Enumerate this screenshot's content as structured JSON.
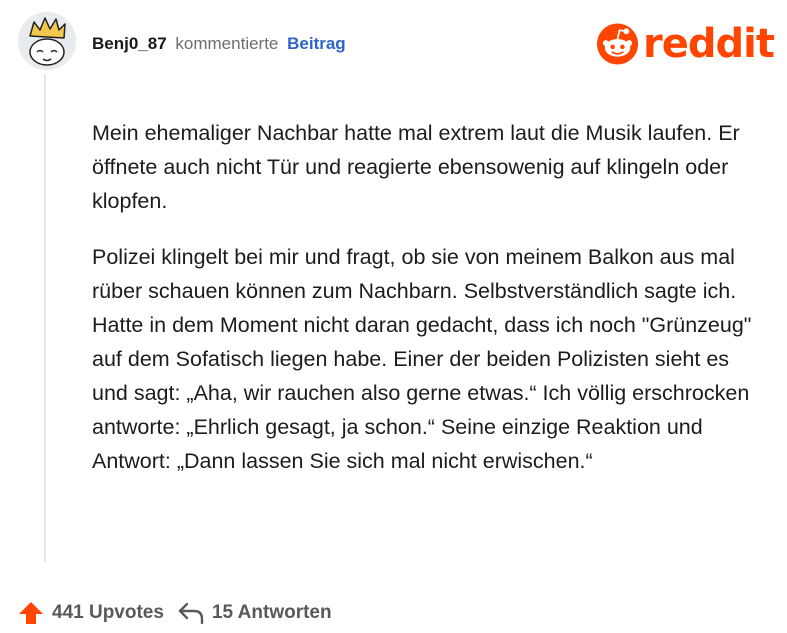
{
  "comment": {
    "username": "Benj0_87",
    "action": "kommentierte",
    "post_link": "Beitrag",
    "paragraphs": [
      "Mein ehemaliger Nachbar hatte mal extrem laut die Musik laufen. Er öffnete auch nicht Tür und reagierte ebensowenig auf klingeln oder klopfen.",
      "Polizei klingelt bei mir und fragt, ob sie von meinem Balkon aus mal rüber schauen können zum Nachbarn. Selbstverständlich sagte ich. Hatte in dem Moment nicht daran gedacht, dass ich noch \"Grünzeug\" auf dem Sofatisch liegen habe. Einer der beiden Polizisten sieht es und sagt: „Aha, wir rauchen also gerne etwas.“ Ich völlig erschrocken antworte: „Ehrlich gesagt, ja schon.“ Seine einzige Reaktion und Antwort: „Dann lassen Sie sich mal nicht erwischen.“"
    ]
  },
  "brand": {
    "wordmark": "reddit",
    "color": "#ff4500"
  },
  "footer": {
    "upvotes": "441 Upvotes",
    "replies": "15 Antworten",
    "upvote_icon": "upvote-arrow-icon",
    "reply_icon": "reply-arrow-icon",
    "upvote_color": "#ff4500"
  }
}
